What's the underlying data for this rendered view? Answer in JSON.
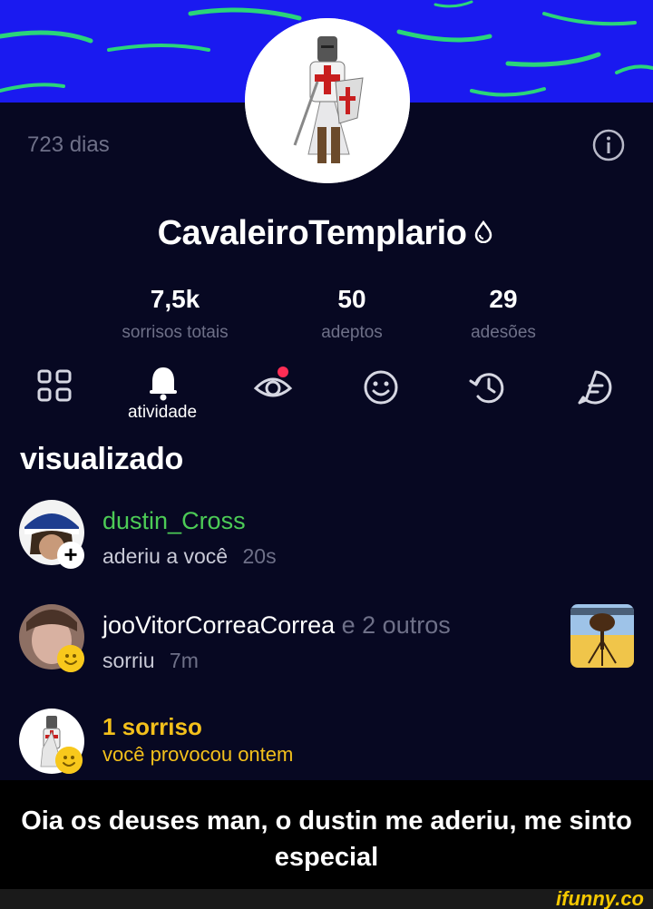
{
  "profile": {
    "days": "723 dias",
    "username": "CavaleiroTemplario",
    "stats": [
      {
        "value": "7,5k",
        "label": "sorrisos totais"
      },
      {
        "value": "50",
        "label": "adeptos"
      },
      {
        "value": "29",
        "label": "adesões"
      }
    ]
  },
  "tabs": {
    "active_label": "atividade",
    "icons": [
      "grid-icon",
      "bell-icon",
      "eye-icon",
      "smile-icon",
      "history-icon",
      "chat-icon"
    ]
  },
  "section": {
    "title": "visualizado"
  },
  "notifications": [
    {
      "user": "dustin_Cross",
      "action": "aderiu a você",
      "time": "20s"
    },
    {
      "user": "jooVitorCorreaCorrea",
      "connector": "e 2 outros",
      "action": "sorriu",
      "time": "7m"
    },
    {
      "title": "1 sorriso",
      "action": "você provocou ontem"
    }
  ],
  "caption": "Oia os deuses man, o dustin me aderiu, me sinto especial",
  "watermark": "ifunny.co",
  "colors": {
    "banner": "#1a1af0",
    "background": "#070822",
    "accent_green": "#4ccb56",
    "accent_yellow": "#f3c01b",
    "muted": "#6e7088"
  }
}
